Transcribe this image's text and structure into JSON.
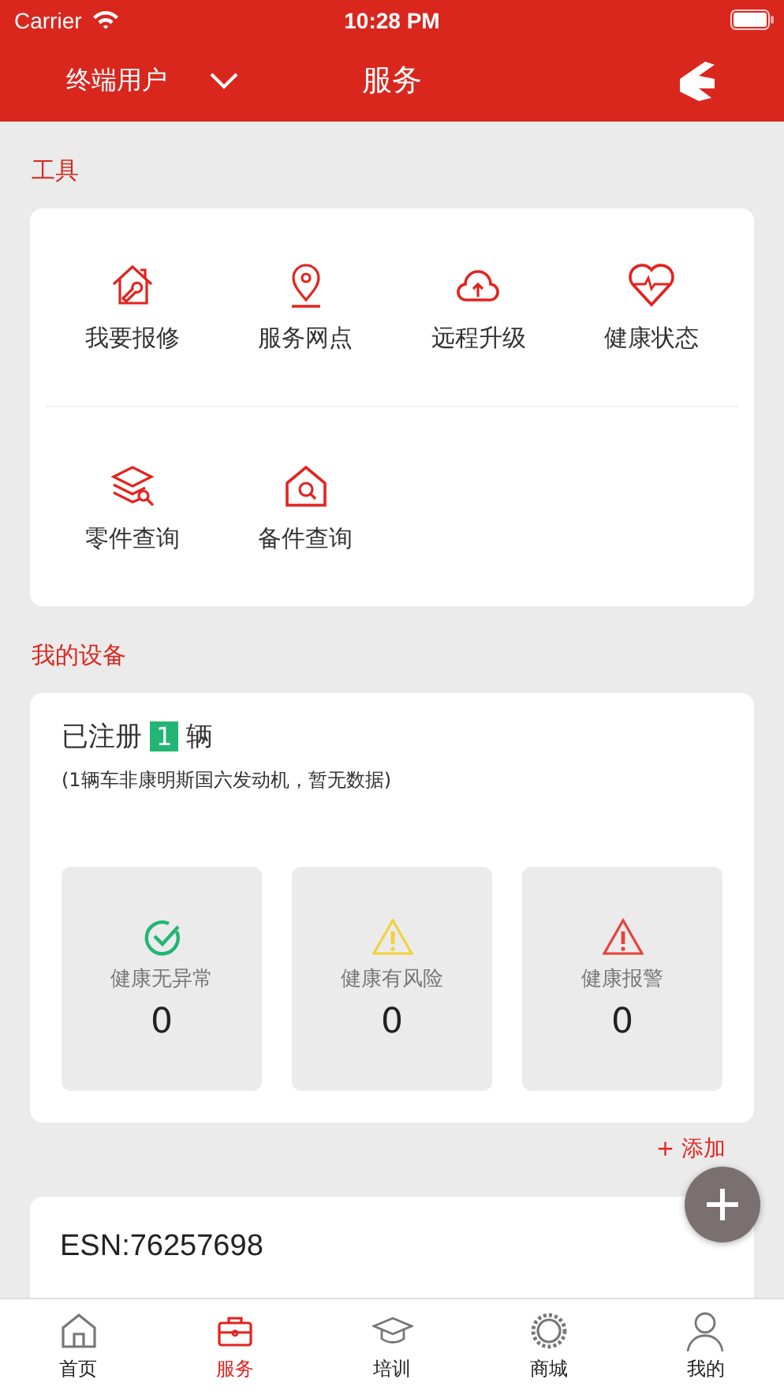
{
  "status_bar": {
    "carrier": "Carrier",
    "time": "10:28 PM"
  },
  "nav_bar": {
    "user_menu": "终端用户",
    "title": "服务"
  },
  "tools": {
    "title": "工具",
    "items": [
      {
        "label": "我要报修",
        "kind": "repair"
      },
      {
        "label": "服务网点",
        "kind": "location"
      },
      {
        "label": "远程升级",
        "kind": "upgrade"
      },
      {
        "label": "健康状态",
        "kind": "health"
      },
      {
        "label": "零件查询",
        "kind": "parts"
      },
      {
        "label": "备件查询",
        "kind": "spares"
      }
    ]
  },
  "devices": {
    "title": "我的设备",
    "registered_prefix": "已注册",
    "registered_count": "1",
    "registered_suffix": "辆",
    "note": "(1辆车非康明斯国六发动机，暂无数据)",
    "stats": [
      {
        "label": "健康无异常",
        "value": "0",
        "kind": "ok"
      },
      {
        "label": "健康有风险",
        "value": "0",
        "kind": "risk"
      },
      {
        "label": "健康报警",
        "value": "0",
        "kind": "alarm"
      }
    ]
  },
  "add_link": "+ 添加",
  "esn": "ESN:76257698",
  "tab_bar": [
    {
      "label": "首页",
      "kind": "home",
      "selected": false
    },
    {
      "label": "服务",
      "kind": "service",
      "selected": true
    },
    {
      "label": "培训",
      "kind": "training",
      "selected": false
    },
    {
      "label": "商城",
      "kind": "mall",
      "selected": false
    },
    {
      "label": "我的",
      "kind": "profile",
      "selected": false
    }
  ]
}
